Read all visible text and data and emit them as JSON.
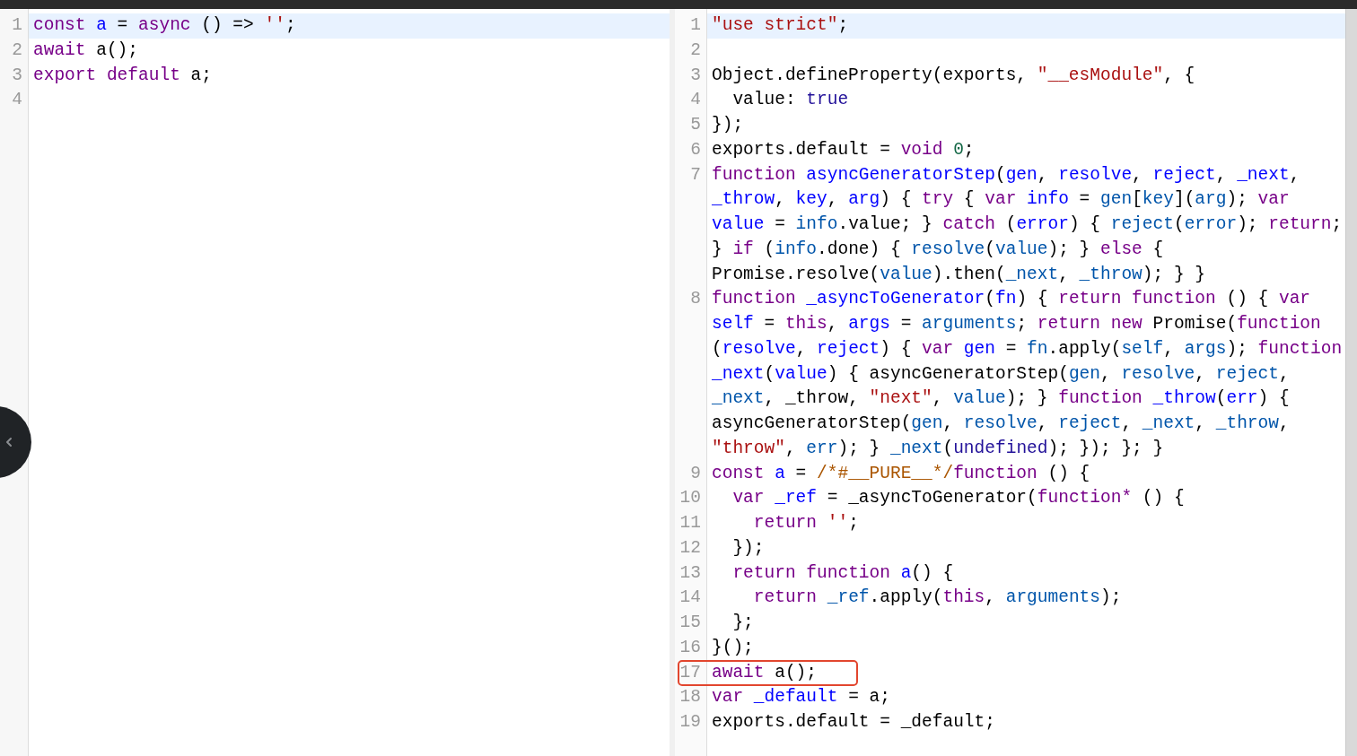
{
  "input_editor": {
    "lines": [
      {
        "number": "1",
        "active": true,
        "boxed": false,
        "tokens": [
          {
            "kind": "keyword",
            "text": "const"
          },
          {
            "kind": "def",
            "text": " a"
          },
          {
            "kind": "plain",
            "text": " ="
          },
          {
            "kind": "keyword",
            "text": " async"
          },
          {
            "kind": "plain",
            "text": " () =>"
          },
          {
            "kind": "string",
            "text": " ''"
          },
          {
            "kind": "plain",
            "text": ";"
          }
        ]
      },
      {
        "number": "2",
        "active": false,
        "boxed": false,
        "tokens": [
          {
            "kind": "keyword",
            "text": "await"
          },
          {
            "kind": "plain",
            "text": " a();"
          }
        ]
      },
      {
        "number": "3",
        "active": false,
        "boxed": false,
        "tokens": [
          {
            "kind": "keyword",
            "text": "export"
          },
          {
            "kind": "keyword",
            "text": " default"
          },
          {
            "kind": "plain",
            "text": " a;"
          }
        ]
      },
      {
        "number": "4",
        "active": false,
        "boxed": false
      }
    ]
  },
  "output_editor": {
    "lines": [
      {
        "number": "1",
        "active": true,
        "boxed": false,
        "tokens": [
          {
            "kind": "string",
            "text": "\"use strict\""
          },
          {
            "kind": "plain",
            "text": ";"
          }
        ]
      },
      {
        "number": "2",
        "active": false,
        "boxed": false
      },
      {
        "number": "3",
        "active": false,
        "boxed": false,
        "tokens": [
          {
            "kind": "plain",
            "text": "Object.defineProperty(exports,"
          },
          {
            "kind": "string",
            "text": " \"__esModule\""
          },
          {
            "kind": "plain",
            "text": ", {"
          }
        ]
      },
      {
        "number": "4",
        "active": false,
        "boxed": false,
        "tokens": [
          {
            "kind": "plain",
            "text": "  value:"
          },
          {
            "kind": "atom",
            "text": " true"
          }
        ]
      },
      {
        "number": "5",
        "active": false,
        "boxed": false,
        "tokens": [
          {
            "kind": "plain",
            "text": "});"
          }
        ]
      },
      {
        "number": "6",
        "active": false,
        "boxed": false,
        "tokens": [
          {
            "kind": "plain",
            "text": "exports.default ="
          },
          {
            "kind": "keyword",
            "text": " void"
          },
          {
            "kind": "number",
            "text": " 0"
          },
          {
            "kind": "plain",
            "text": ";"
          }
        ]
      },
      {
        "number": "7",
        "active": false,
        "boxed": false,
        "tokens": [
          {
            "kind": "keyword",
            "text": "function"
          },
          {
            "kind": "def",
            "text": " asyncGeneratorStep"
          },
          {
            "kind": "plain",
            "text": "("
          },
          {
            "kind": "def",
            "text": "gen"
          },
          {
            "kind": "plain",
            "text": ","
          },
          {
            "kind": "def",
            "text": " resolve"
          },
          {
            "kind": "plain",
            "text": ","
          },
          {
            "kind": "def",
            "text": " reject"
          },
          {
            "kind": "plain",
            "text": ","
          },
          {
            "kind": "def",
            "text": " _next"
          },
          {
            "kind": "plain",
            "text": ","
          },
          {
            "kind": "def",
            "text": " _throw"
          },
          {
            "kind": "plain",
            "text": ","
          },
          {
            "kind": "def",
            "text": " key"
          },
          {
            "kind": "plain",
            "text": ","
          },
          {
            "kind": "def",
            "text": " arg"
          },
          {
            "kind": "plain",
            "text": ") {"
          },
          {
            "kind": "keyword",
            "text": " try"
          },
          {
            "kind": "plain",
            "text": " {"
          },
          {
            "kind": "keyword",
            "text": " var"
          },
          {
            "kind": "def",
            "text": " info"
          },
          {
            "kind": "plain",
            "text": " ="
          },
          {
            "kind": "variable",
            "text": " gen"
          },
          {
            "kind": "plain",
            "text": "["
          },
          {
            "kind": "variable",
            "text": "key"
          },
          {
            "kind": "plain",
            "text": "]("
          },
          {
            "kind": "variable",
            "text": "arg"
          },
          {
            "kind": "plain",
            "text": ");"
          },
          {
            "kind": "keyword",
            "text": " var"
          },
          {
            "kind": "def",
            "text": " value"
          },
          {
            "kind": "plain",
            "text": " ="
          },
          {
            "kind": "variable",
            "text": " info"
          },
          {
            "kind": "plain",
            "text": ".value; }"
          },
          {
            "kind": "keyword",
            "text": " catch"
          },
          {
            "kind": "plain",
            "text": " ("
          },
          {
            "kind": "def",
            "text": "error"
          },
          {
            "kind": "plain",
            "text": ") {"
          },
          {
            "kind": "variable",
            "text": " reject"
          },
          {
            "kind": "plain",
            "text": "("
          },
          {
            "kind": "variable",
            "text": "error"
          },
          {
            "kind": "plain",
            "text": ");"
          },
          {
            "kind": "keyword",
            "text": " return"
          },
          {
            "kind": "plain",
            "text": "; }"
          },
          {
            "kind": "keyword",
            "text": " if"
          },
          {
            "kind": "plain",
            "text": " ("
          },
          {
            "kind": "variable",
            "text": "info"
          },
          {
            "kind": "plain",
            "text": ".done) {"
          },
          {
            "kind": "variable",
            "text": " resolve"
          },
          {
            "kind": "plain",
            "text": "("
          },
          {
            "kind": "variable",
            "text": "value"
          },
          {
            "kind": "plain",
            "text": "); }"
          },
          {
            "kind": "keyword",
            "text": " else"
          },
          {
            "kind": "plain",
            "text": " { Promise.resolve("
          },
          {
            "kind": "variable",
            "text": "value"
          },
          {
            "kind": "plain",
            "text": ").then("
          },
          {
            "kind": "variable",
            "text": "_next"
          },
          {
            "kind": "plain",
            "text": ","
          },
          {
            "kind": "variable",
            "text": " _throw"
          },
          {
            "kind": "plain",
            "text": "); } }"
          }
        ]
      },
      {
        "number": "8",
        "active": false,
        "boxed": false,
        "tokens": [
          {
            "kind": "keyword",
            "text": "function"
          },
          {
            "kind": "def",
            "text": " _asyncToGenerator"
          },
          {
            "kind": "plain",
            "text": "("
          },
          {
            "kind": "def",
            "text": "fn"
          },
          {
            "kind": "plain",
            "text": ") {"
          },
          {
            "kind": "keyword",
            "text": " return"
          },
          {
            "kind": "keyword",
            "text": " function"
          },
          {
            "kind": "plain",
            "text": " () {"
          },
          {
            "kind": "keyword",
            "text": " var"
          },
          {
            "kind": "def",
            "text": " self"
          },
          {
            "kind": "plain",
            "text": " ="
          },
          {
            "kind": "keyword",
            "text": " this"
          },
          {
            "kind": "plain",
            "text": ","
          },
          {
            "kind": "def",
            "text": " args"
          },
          {
            "kind": "plain",
            "text": " ="
          },
          {
            "kind": "variable",
            "text": " arguments"
          },
          {
            "kind": "plain",
            "text": ";"
          },
          {
            "kind": "keyword",
            "text": " return"
          },
          {
            "kind": "keyword",
            "text": " new"
          },
          {
            "kind": "plain",
            "text": " Promise("
          },
          {
            "kind": "keyword",
            "text": "function"
          },
          {
            "kind": "plain",
            "text": " ("
          },
          {
            "kind": "def",
            "text": "resolve"
          },
          {
            "kind": "plain",
            "text": ","
          },
          {
            "kind": "def",
            "text": " reject"
          },
          {
            "kind": "plain",
            "text": ") {"
          },
          {
            "kind": "keyword",
            "text": " var"
          },
          {
            "kind": "def",
            "text": " gen"
          },
          {
            "kind": "plain",
            "text": " ="
          },
          {
            "kind": "variable",
            "text": " fn"
          },
          {
            "kind": "plain",
            "text": ".apply("
          },
          {
            "kind": "variable",
            "text": "self"
          },
          {
            "kind": "plain",
            "text": ","
          },
          {
            "kind": "variable",
            "text": " args"
          },
          {
            "kind": "plain",
            "text": ");"
          },
          {
            "kind": "keyword",
            "text": " function"
          },
          {
            "kind": "def",
            "text": " _next"
          },
          {
            "kind": "plain",
            "text": "("
          },
          {
            "kind": "def",
            "text": "value"
          },
          {
            "kind": "plain",
            "text": ") { asyncGeneratorStep("
          },
          {
            "kind": "variable",
            "text": "gen"
          },
          {
            "kind": "plain",
            "text": ","
          },
          {
            "kind": "variable",
            "text": " resolve"
          },
          {
            "kind": "plain",
            "text": ","
          },
          {
            "kind": "variable",
            "text": " reject"
          },
          {
            "kind": "plain",
            "text": ","
          },
          {
            "kind": "variable",
            "text": " _next"
          },
          {
            "kind": "plain",
            "text": ", _throw,"
          },
          {
            "kind": "string",
            "text": " \"next\""
          },
          {
            "kind": "plain",
            "text": ","
          },
          {
            "kind": "variable",
            "text": " value"
          },
          {
            "kind": "plain",
            "text": "); }"
          },
          {
            "kind": "keyword",
            "text": " function"
          },
          {
            "kind": "def",
            "text": " _throw"
          },
          {
            "kind": "plain",
            "text": "("
          },
          {
            "kind": "def",
            "text": "err"
          },
          {
            "kind": "plain",
            "text": ") { asyncGeneratorStep("
          },
          {
            "kind": "variable",
            "text": "gen"
          },
          {
            "kind": "plain",
            "text": ","
          },
          {
            "kind": "variable",
            "text": " resolve"
          },
          {
            "kind": "plain",
            "text": ","
          },
          {
            "kind": "variable",
            "text": " reject"
          },
          {
            "kind": "plain",
            "text": ","
          },
          {
            "kind": "variable",
            "text": " _next"
          },
          {
            "kind": "plain",
            "text": ","
          },
          {
            "kind": "variable",
            "text": " _throw"
          },
          {
            "kind": "plain",
            "text": ","
          },
          {
            "kind": "string",
            "text": " \"throw\""
          },
          {
            "kind": "plain",
            "text": ","
          },
          {
            "kind": "variable",
            "text": " err"
          },
          {
            "kind": "plain",
            "text": "); }"
          },
          {
            "kind": "variable",
            "text": " _next"
          },
          {
            "kind": "plain",
            "text": "("
          },
          {
            "kind": "atom",
            "text": "undefined"
          },
          {
            "kind": "plain",
            "text": "); }); }; }"
          }
        ]
      },
      {
        "number": "9",
        "active": false,
        "boxed": false,
        "tokens": [
          {
            "kind": "keyword",
            "text": "const"
          },
          {
            "kind": "def",
            "text": " a"
          },
          {
            "kind": "plain",
            "text": " ="
          },
          {
            "kind": "comment",
            "text": " /*#__PURE__*/"
          },
          {
            "kind": "keyword",
            "text": "function"
          },
          {
            "kind": "plain",
            "text": " () {"
          }
        ]
      },
      {
        "number": "10",
        "active": false,
        "boxed": false,
        "tokens": [
          {
            "kind": "keyword",
            "text": "  var"
          },
          {
            "kind": "def",
            "text": " _ref"
          },
          {
            "kind": "plain",
            "text": " = _asyncToGenerator("
          },
          {
            "kind": "keyword",
            "text": "function*"
          },
          {
            "kind": "plain",
            "text": " () {"
          }
        ]
      },
      {
        "number": "11",
        "active": false,
        "boxed": false,
        "tokens": [
          {
            "kind": "keyword",
            "text": "    return"
          },
          {
            "kind": "string",
            "text": " ''"
          },
          {
            "kind": "plain",
            "text": ";"
          }
        ]
      },
      {
        "number": "12",
        "active": false,
        "boxed": false,
        "tokens": [
          {
            "kind": "plain",
            "text": "  });"
          }
        ]
      },
      {
        "number": "13",
        "active": false,
        "boxed": false,
        "tokens": [
          {
            "kind": "keyword",
            "text": "  return"
          },
          {
            "kind": "keyword",
            "text": " function"
          },
          {
            "kind": "def",
            "text": " a"
          },
          {
            "kind": "plain",
            "text": "() {"
          }
        ]
      },
      {
        "number": "14",
        "active": false,
        "boxed": false,
        "tokens": [
          {
            "kind": "keyword",
            "text": "    return"
          },
          {
            "kind": "variable",
            "text": " _ref"
          },
          {
            "kind": "plain",
            "text": ".apply("
          },
          {
            "kind": "keyword",
            "text": "this"
          },
          {
            "kind": "plain",
            "text": ","
          },
          {
            "kind": "variable",
            "text": " arguments"
          },
          {
            "kind": "plain",
            "text": ");"
          }
        ]
      },
      {
        "number": "15",
        "active": false,
        "boxed": false,
        "tokens": [
          {
            "kind": "plain",
            "text": "  };"
          }
        ]
      },
      {
        "number": "16",
        "active": false,
        "boxed": false,
        "tokens": [
          {
            "kind": "plain",
            "text": "}();"
          }
        ]
      },
      {
        "number": "17",
        "active": false,
        "boxed": true,
        "tokens": [
          {
            "kind": "keyword",
            "text": "await"
          },
          {
            "kind": "plain",
            "text": " a();"
          }
        ]
      },
      {
        "number": "18",
        "active": false,
        "boxed": false,
        "tokens": [
          {
            "kind": "keyword",
            "text": "var"
          },
          {
            "kind": "def",
            "text": " _default"
          },
          {
            "kind": "plain",
            "text": " = a;"
          }
        ]
      },
      {
        "number": "19",
        "active": false,
        "boxed": false,
        "tokens": [
          {
            "kind": "plain",
            "text": "exports.default = _default;"
          }
        ]
      }
    ]
  }
}
